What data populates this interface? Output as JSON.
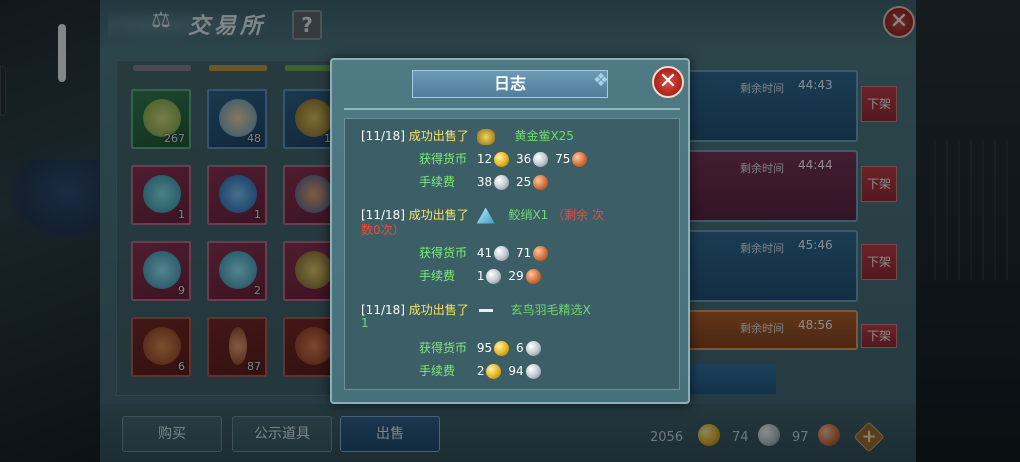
{
  "exchange": {
    "title": "交易所",
    "help_label": "?",
    "close_label": "✕"
  },
  "grid": {
    "quantities": [
      "267",
      "48",
      "1",
      "1",
      "1",
      "9",
      "2",
      "6",
      "87"
    ]
  },
  "listings": [
    {
      "time_label": "剩余时间",
      "time_value": "44:43",
      "unlist_label": "下架"
    },
    {
      "time_label": "剩余时间",
      "time_value": "44:44",
      "unlist_label": "下架"
    },
    {
      "time_label": "剩余时间",
      "time_value": "45:46",
      "unlist_label": "下架"
    },
    {
      "time_label": "剩余时间",
      "time_value": "48:56",
      "unlist_label": "下架"
    }
  ],
  "tabs": {
    "buy": "购买",
    "showcase": "公示道具",
    "sell": "出售"
  },
  "currency": {
    "gold": "2056",
    "silver": "74",
    "bronze": "97",
    "plus_label": "+"
  },
  "log": {
    "title": "日志",
    "close_label": "✕",
    "entries": [
      {
        "date": "[11/18]",
        "sold_text": "成功出售了",
        "item_text": "黄金鲎X25",
        "earned_label": "获得货币",
        "earned": [
          "12",
          "36",
          "75"
        ],
        "fee_label": "手续费",
        "fee": [
          "38",
          "25"
        ]
      },
      {
        "date": "[11/18]",
        "sold_text": "成功出售了",
        "item_text": "鲛绡X1",
        "note_text": "（剩余 次",
        "note_text_2": "数0次）",
        "earned_label": "获得货币",
        "earned": [
          "41",
          "71"
        ],
        "fee_label": "手续费",
        "fee": [
          "1",
          "29"
        ]
      },
      {
        "date": "[11/18]",
        "sold_text": "成功出售了",
        "item_text": "玄鸟羽毛精选X",
        "item_text_2": "1",
        "earned_label": "获得货币",
        "earned": [
          "95",
          "6"
        ],
        "fee_label": "手续费",
        "fee": [
          "2",
          "94"
        ]
      }
    ]
  }
}
